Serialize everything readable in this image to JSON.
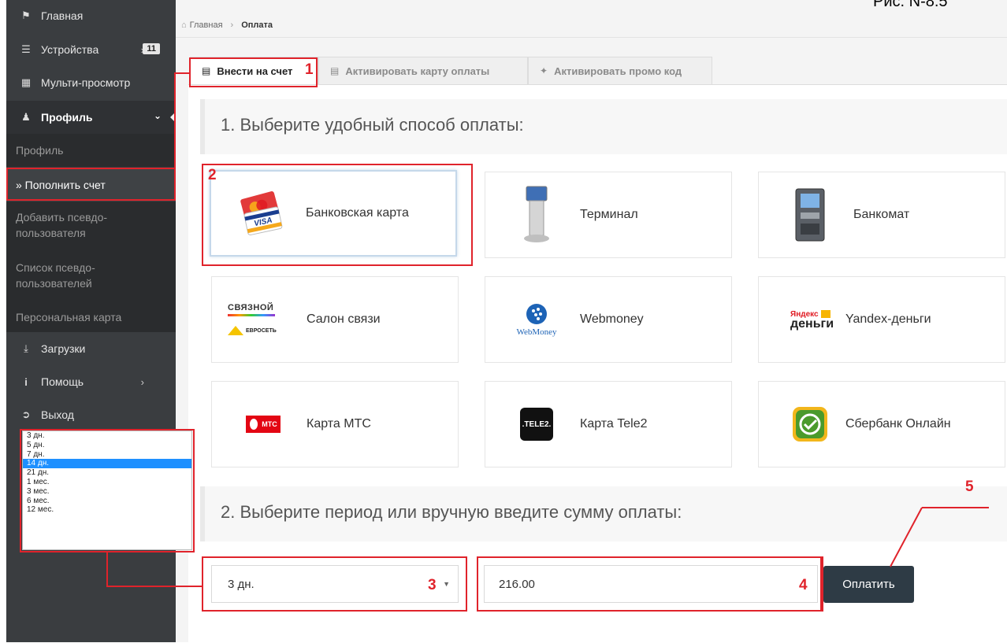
{
  "caption": "Рис. N-8.5",
  "sidebar": {
    "home": "Главная",
    "devices": "Устройства",
    "devices_count": "11",
    "multiview": "Мульти-просмотр",
    "profile": "Профиль",
    "profile_sub": "Профиль",
    "topup": "» Пополнить счет",
    "add_pseudo": "Добавить псевдо-пользователя",
    "pseudo_list": "Список псевдо-пользователей",
    "personal_card": "Персональная карта",
    "downloads": "Загрузки",
    "help": "Помощь",
    "logout": "Выход"
  },
  "breadcrumb": {
    "home": "Главная",
    "current": "Оплата"
  },
  "tabs": {
    "deposit": "Внести на счет",
    "activate_card": "Активировать карту оплаты",
    "activate_promo": "Активировать промо код"
  },
  "step1_title": "1. Выберите удобный способ оплаты:",
  "payment_methods": {
    "bank_card": "Банковская карта",
    "terminal": "Терминал",
    "atm": "Банкомат",
    "salon": "Салон связи",
    "webmoney": "Webmoney",
    "yandex": "Yandex-деньги",
    "mts": "Карта МТС",
    "tele2": "Карта Tele2",
    "sberbank": "Сбербанк Онлайн"
  },
  "logo_text": {
    "svyaznoy": "СВЯЗНОЙ",
    "euroset": "ЕВРОСЕТЬ",
    "webmoney": "WebMoney",
    "yandex_top": "Яндекс",
    "yandex_bottom": "деньги",
    "mts": "МТС",
    "tele2": ".TELE2.",
    "visa": "VISA"
  },
  "step2_title": "2. Выберите период или вручную введите сумму оплаты:",
  "period": {
    "selected": "3 дн."
  },
  "period_options": [
    "3 дн.",
    "5 дн.",
    "7 дн.",
    "14 дн.",
    "21 дн.",
    "1 мес.",
    "3 мес.",
    "6 мес.",
    "12 мес."
  ],
  "period_highlighted": "14 дн.",
  "amount": {
    "value": "216.00"
  },
  "pay_button": "Оплатить",
  "callouts": [
    "1",
    "2",
    "3",
    "4",
    "5"
  ],
  "colors": {
    "sidebar_bg": "#3a3d40",
    "annotation": "#e0232b",
    "pay_button": "#2e3b45",
    "highlight": "#1e90ff"
  }
}
